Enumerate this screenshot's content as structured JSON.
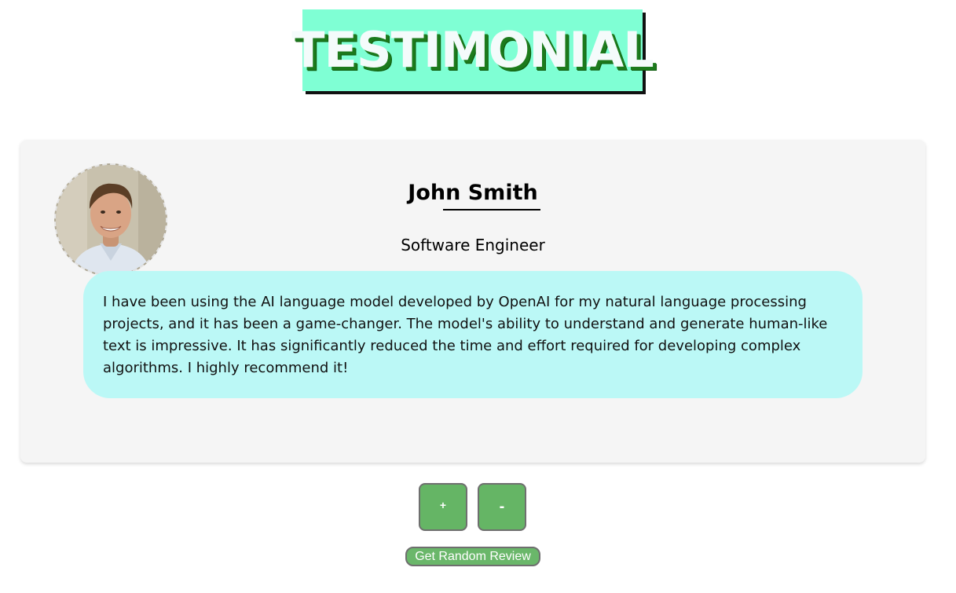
{
  "header": {
    "title": "TESTIMONIAL",
    "banner_color": "#7fffd4",
    "title_shadow_color": "#1c7a1c"
  },
  "testimonial": {
    "avatar_icon": "person-photo",
    "name": "John Smith",
    "job": "Software Engineer",
    "review": "I have been using the AI language model developed by OpenAI for my natural language processing projects, and it has been a game-changer. The model's ability to understand and generate human-like text is impressive. It has significantly reduced the time and effort required for developing complex algorithms. I highly recommend it!",
    "bubble_color": "#bbf8f6",
    "card_color": "#f5f5f5"
  },
  "controls": {
    "next_label": "+",
    "prev_label": "-",
    "random_label": "Get Random Review",
    "button_color": "#65b565"
  }
}
